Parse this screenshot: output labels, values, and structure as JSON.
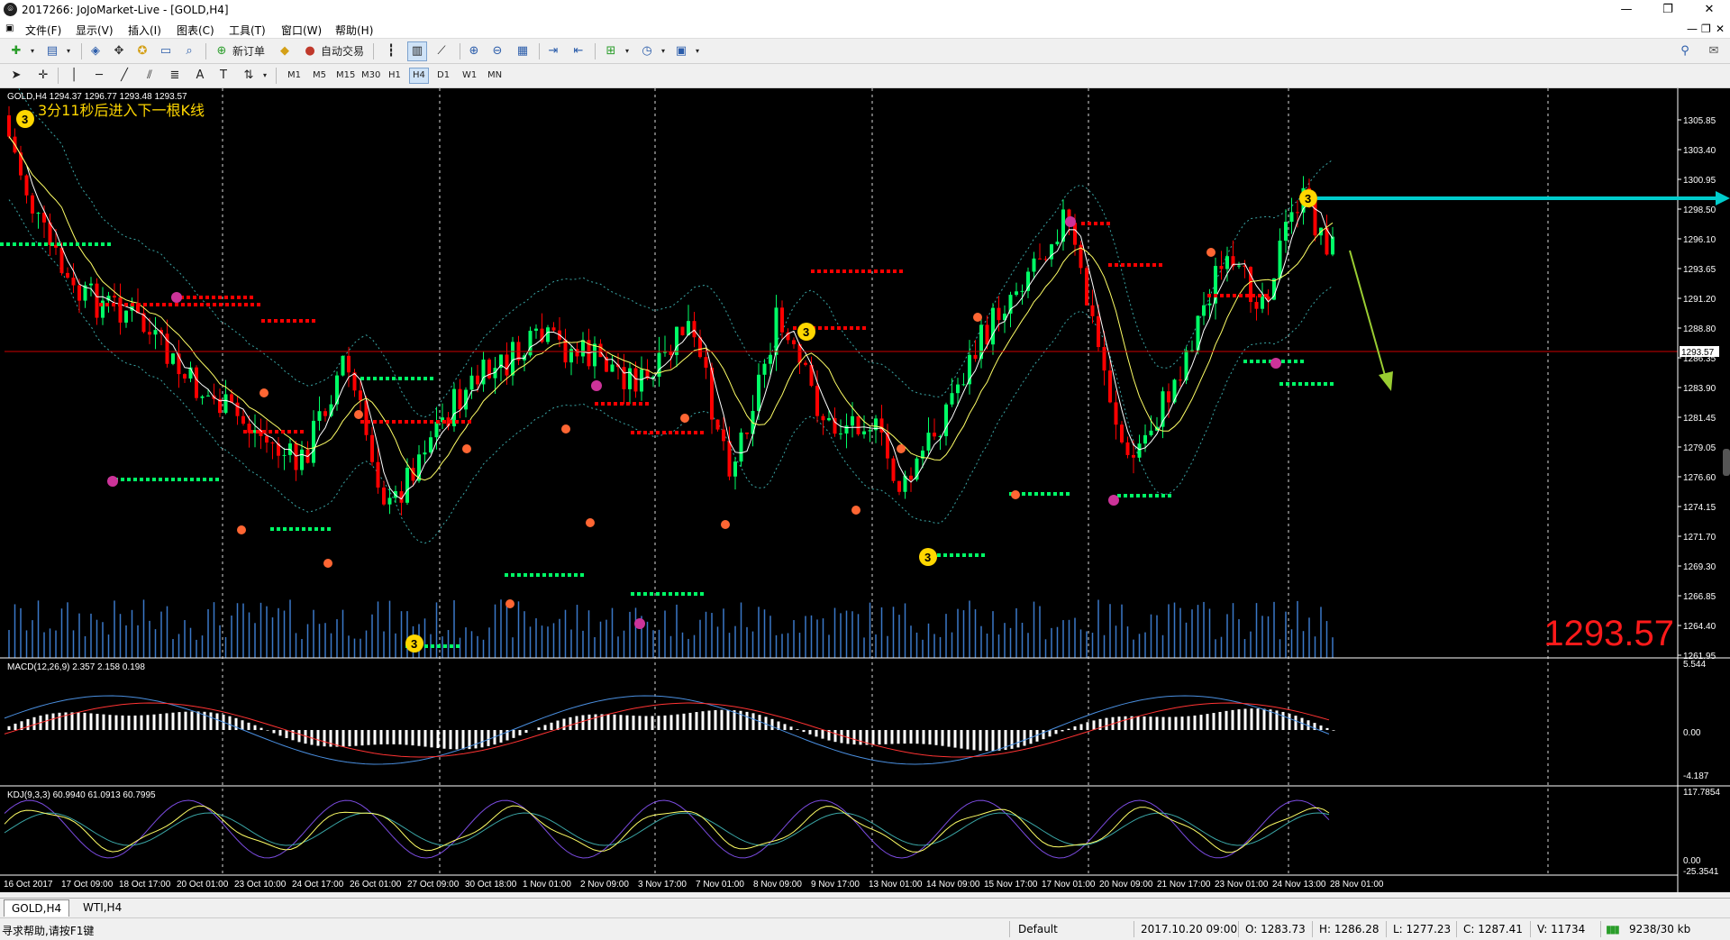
{
  "window": {
    "title": "2017266: JoJoMarket-Live - [GOLD,H4]"
  },
  "menu": [
    "文件(F)",
    "显示(V)",
    "插入(I)",
    "图表(C)",
    "工具(T)",
    "窗口(W)",
    "帮助(H)"
  ],
  "toolbar": {
    "new_order": "新订单",
    "auto_trade": "自动交易"
  },
  "timeframes": [
    "M1",
    "M5",
    "M15",
    "M30",
    "H1",
    "H4",
    "D1",
    "W1",
    "MN"
  ],
  "selected_timeframe": "H4",
  "chart": {
    "header": "GOLD,H4  1294.37 1296.77 1293.48 1293.57",
    "countdown": "3分11秒后进入下一根K线",
    "big_price": "1293.57",
    "current_price_label": "1293.57",
    "price_ticks": [
      "1305.85",
      "1303.40",
      "1300.95",
      "1298.50",
      "1296.10",
      "1293.65",
      "1291.20",
      "1288.80",
      "1286.35",
      "1283.90",
      "1281.45",
      "1279.05",
      "1276.60",
      "1274.15",
      "1271.70",
      "1269.30",
      "1266.85",
      "1264.40",
      "1261.95"
    ],
    "macd_label": "MACD(12,26,9) 2.357 2.158 0.198",
    "macd_ticks": [
      "5.544",
      "0.00",
      "-4.187"
    ],
    "kdj_label": "KDJ(9,3,3) 60.9940 61.0913 60.7995",
    "kdj_ticks": [
      "117.7854",
      "0.00",
      "-25.3541"
    ],
    "time_labels": [
      "16 Oct 2017",
      "17 Oct 09:00",
      "18 Oct 17:00",
      "20 Oct 01:00",
      "23 Oct 10:00",
      "24 Oct 17:00",
      "26 Oct 01:00",
      "27 Oct 09:00",
      "30 Oct 18:00",
      "1 Nov 01:00",
      "2 Nov 09:00",
      "3 Nov 17:00",
      "7 Nov 01:00",
      "8 Nov 09:00",
      "9 Nov 17:00",
      "13 Nov 01:00",
      "14 Nov 09:00",
      "15 Nov 17:00",
      "17 Nov 01:00",
      "20 Nov 09:00",
      "21 Nov 17:00",
      "23 Nov 01:00",
      "24 Nov 13:00",
      "28 Nov 01:00"
    ],
    "colors": {
      "bull": "#00ff66",
      "bear": "#ff0000",
      "background": "#000000",
      "volume": "#3a78c8",
      "arrow_cyan": "#00cccc",
      "arrow_olive": "#9acd32"
    }
  },
  "chart_tabs": [
    "GOLD,H4",
    "WTI,H4"
  ],
  "status": {
    "help": "寻求帮助,请按F1键",
    "profile": "Default",
    "datetime": "2017.10.20 09:00",
    "open": "O: 1283.73",
    "high": "H: 1286.28",
    "low": "L: 1277.23",
    "close": "C: 1287.41",
    "volume": "V: 11734",
    "traffic": "9238/30 kb"
  }
}
